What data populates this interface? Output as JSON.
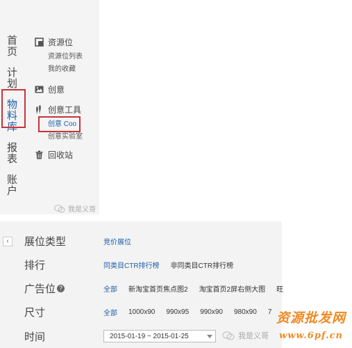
{
  "nav": {
    "items": [
      {
        "label": "首页"
      },
      {
        "label": "计划"
      },
      {
        "label": "物料库"
      },
      {
        "label": "报表"
      },
      {
        "label": "账户"
      }
    ]
  },
  "side": {
    "groups": [
      {
        "label": "资源位",
        "subs": [
          "资源位列表",
          "我的收藏"
        ]
      },
      {
        "label": "创意",
        "subs": []
      },
      {
        "label": "创意工具",
        "subs": [
          "创意 Coo",
          "创意实验室"
        ]
      },
      {
        "label": "回收站",
        "subs": []
      }
    ]
  },
  "watermark": {
    "text": "我是义哥"
  },
  "filters": {
    "type": {
      "label": "展位类型",
      "options": [
        "竞价展位"
      ]
    },
    "rank": {
      "label": "排行",
      "options": [
        "同类目CTR排行榜",
        "非同类目CTR排行榜"
      ]
    },
    "slot": {
      "label": "广告位",
      "options": [
        "全部",
        "新淘宝首页焦点图2",
        "淘宝首页2屏右侧大图",
        "旺"
      ]
    },
    "size": {
      "label": "尺寸",
      "options": [
        "全部",
        "1000x90",
        "990x95",
        "990x90",
        "980x90",
        "7"
      ]
    },
    "time": {
      "label": "时间",
      "value": "2015-01-19 ~ 2015-01-25"
    }
  },
  "bottom_watermark": {
    "text": "我是义哥"
  },
  "brand": {
    "line1": "资源批发网",
    "line2": "www.6pf.cn"
  }
}
